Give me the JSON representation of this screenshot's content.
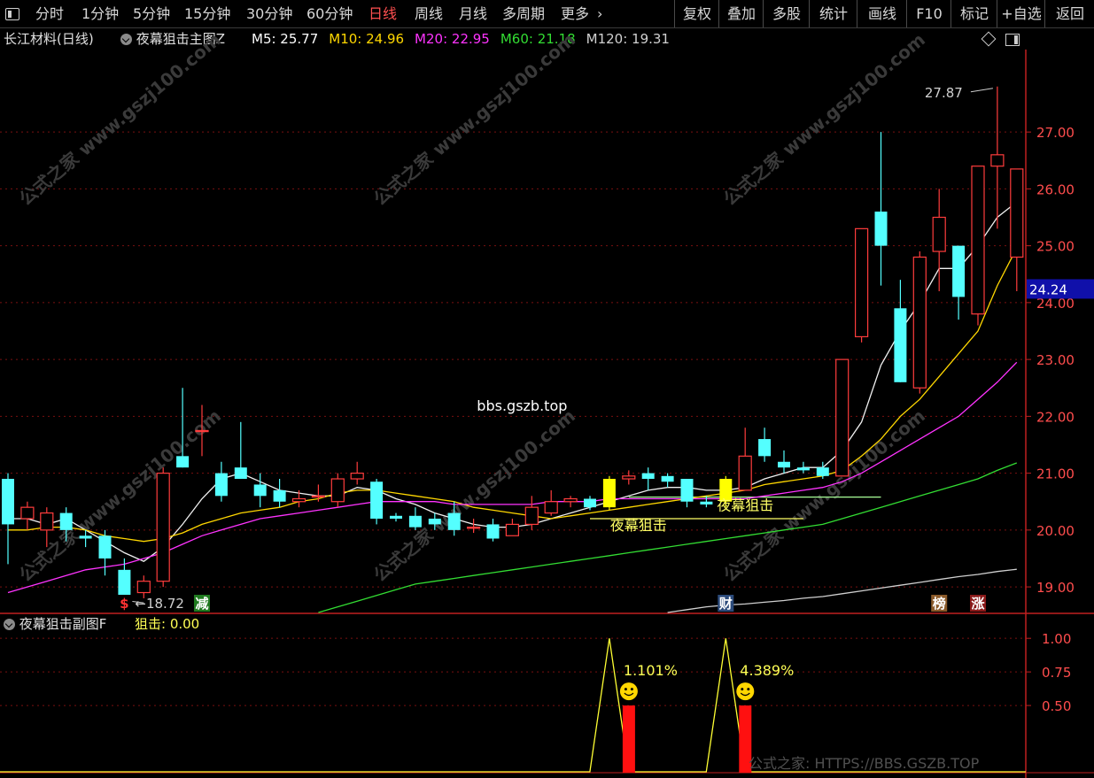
{
  "toolbar": {
    "periods": [
      "分时",
      "1分钟",
      "5分钟",
      "15分钟",
      "30分钟",
      "60分钟",
      "日线",
      "周线",
      "月线",
      "多周期",
      "更多"
    ],
    "more_icon": "chevron-right-icon",
    "right_buttons": [
      "复权",
      "叠加",
      "多股",
      "统计",
      "画线",
      "F10",
      "标记",
      "+自选",
      "返回"
    ]
  },
  "header": {
    "stock": "长江材料(日线)",
    "indicator": "夜幕狙击主图Z",
    "ma": [
      {
        "label": "M5: 25.77",
        "color": "#ffffff"
      },
      {
        "label": "M10: 24.96",
        "color": "#ffd700"
      },
      {
        "label": "M20: 22.95",
        "color": "#ff33ff"
      },
      {
        "label": "M60: 21.18",
        "color": "#33dd33"
      },
      {
        "label": "M120: 19.31",
        "color": "#d0d0d0"
      }
    ]
  },
  "chart_data": {
    "type": "candlestick",
    "ylim": [
      18.55,
      28.45
    ],
    "y_ticks": [
      "19.00",
      "20.00",
      "21.00",
      "22.00",
      "23.00",
      "24.00",
      "25.00",
      "26.00",
      "27.00"
    ],
    "current_price": "24.24",
    "high_label": "27.87",
    "low_label": "18.72",
    "candles": [
      [
        20.9,
        20.1,
        21.0,
        19.4
      ],
      [
        20.2,
        20.4,
        20.5,
        20.0
      ],
      [
        20.0,
        20.3,
        20.4,
        19.7
      ],
      [
        20.3,
        20.0,
        20.4,
        19.8
      ],
      [
        19.9,
        19.85,
        20.0,
        19.7
      ],
      [
        19.9,
        19.5,
        20.0,
        19.2
      ],
      [
        19.3,
        18.8,
        19.5,
        18.7
      ],
      [
        18.9,
        19.1,
        19.2,
        18.8
      ],
      [
        19.1,
        21.0,
        21.1,
        19.0
      ],
      [
        21.3,
        21.1,
        22.5,
        21.1
      ],
      [
        21.75,
        21.75,
        22.2,
        21.3
      ],
      [
        21.0,
        20.6,
        21.2,
        20.5
      ],
      [
        21.1,
        20.9,
        21.9,
        20.9
      ],
      [
        20.8,
        20.6,
        21.0,
        20.4
      ],
      [
        20.7,
        20.5,
        20.9,
        20.4
      ],
      [
        20.5,
        20.55,
        20.7,
        20.4
      ],
      [
        20.6,
        20.6,
        20.8,
        20.5
      ],
      [
        20.5,
        20.9,
        21.0,
        20.4
      ],
      [
        20.9,
        21.0,
        21.2,
        20.8
      ],
      [
        20.85,
        20.2,
        20.9,
        20.1
      ],
      [
        20.25,
        20.2,
        20.3,
        20.15
      ],
      [
        20.25,
        20.05,
        20.4,
        20.0
      ],
      [
        20.2,
        20.1,
        20.3,
        20.0
      ],
      [
        20.3,
        20.0,
        20.5,
        19.9
      ],
      [
        20.05,
        20.05,
        20.2,
        19.95
      ],
      [
        20.1,
        19.85,
        20.2,
        19.8
      ],
      [
        19.9,
        20.1,
        20.2,
        19.9
      ],
      [
        20.1,
        20.4,
        20.6,
        20.0
      ],
      [
        20.3,
        20.5,
        20.7,
        20.25
      ],
      [
        20.5,
        20.55,
        20.6,
        20.4
      ],
      [
        20.55,
        20.4,
        20.6,
        20.35
      ],
      [
        20.4,
        20.9,
        20.95,
        20.35
      ],
      [
        20.9,
        20.95,
        21.05,
        20.8
      ],
      [
        21.0,
        20.9,
        21.1,
        20.7
      ],
      [
        20.95,
        20.85,
        21.0,
        20.75
      ],
      [
        20.9,
        20.5,
        20.9,
        20.4
      ],
      [
        20.5,
        20.45,
        20.6,
        20.4
      ],
      [
        20.5,
        20.9,
        20.95,
        20.4
      ],
      [
        20.7,
        21.3,
        21.8,
        20.7
      ],
      [
        21.6,
        21.3,
        21.8,
        21.2
      ],
      [
        21.2,
        21.1,
        21.4,
        21.0
      ],
      [
        21.1,
        21.05,
        21.2,
        21.0
      ],
      [
        21.1,
        20.95,
        21.2,
        20.9
      ],
      [
        20.95,
        23.0,
        23.0,
        20.95
      ],
      [
        23.4,
        25.3,
        25.3,
        23.3
      ],
      [
        25.6,
        25.0,
        27.0,
        24.3
      ],
      [
        23.9,
        22.6,
        24.4,
        22.6
      ],
      [
        22.5,
        24.8,
        24.9,
        22.4
      ],
      [
        24.9,
        25.5,
        26.0,
        24.2
      ],
      [
        25.0,
        24.1,
        25.0,
        23.7
      ],
      [
        23.8,
        26.4,
        26.4,
        23.6
      ],
      [
        26.4,
        26.6,
        27.8,
        25.3
      ],
      [
        24.8,
        26.35,
        26.35,
        24.2
      ]
    ],
    "up_color": "#ff3c3c",
    "down_color": "#54ffff",
    "ma_series": [
      {
        "name": "M5",
        "color": "#f0f0f0",
        "values": [
          20.2,
          20.2,
          20.1,
          20.2,
          20.0,
          19.8,
          19.6,
          19.45,
          19.7,
          20.1,
          20.55,
          20.9,
          21.0,
          20.85,
          20.7,
          20.65,
          20.6,
          20.6,
          20.75,
          20.7,
          20.55,
          20.45,
          20.3,
          20.2,
          20.1,
          20.05,
          20.05,
          20.1,
          20.2,
          20.3,
          20.4,
          20.5,
          20.6,
          20.7,
          20.75,
          20.75,
          20.7,
          20.7,
          20.75,
          20.9,
          21.0,
          21.1,
          21.1,
          21.4,
          21.9,
          22.9,
          23.5,
          24.0,
          24.6,
          24.6,
          25.0,
          25.5,
          25.77
        ]
      },
      {
        "name": "M10",
        "color": "#ffd700",
        "values": [
          20.0,
          20.0,
          20.05,
          20.05,
          20.0,
          19.9,
          19.85,
          19.8,
          19.85,
          19.95,
          20.1,
          20.2,
          20.3,
          20.35,
          20.4,
          20.5,
          20.55,
          20.65,
          20.7,
          20.7,
          20.65,
          20.6,
          20.55,
          20.5,
          20.4,
          20.35,
          20.3,
          20.25,
          20.2,
          20.25,
          20.3,
          20.35,
          20.4,
          20.45,
          20.5,
          20.55,
          20.6,
          20.65,
          20.7,
          20.8,
          20.85,
          20.9,
          20.95,
          21.05,
          21.3,
          21.6,
          22.0,
          22.3,
          22.7,
          23.1,
          23.5,
          24.3,
          24.96
        ]
      },
      {
        "name": "M20",
        "color": "#ff33ff",
        "values": [
          18.9,
          19.0,
          19.1,
          19.2,
          19.3,
          19.35,
          19.4,
          19.5,
          19.6,
          19.75,
          19.9,
          20.0,
          20.1,
          20.2,
          20.25,
          20.3,
          20.35,
          20.4,
          20.45,
          20.5,
          20.5,
          20.5,
          20.5,
          20.45,
          20.45,
          20.45,
          20.45,
          20.45,
          20.5,
          20.5,
          20.5,
          20.55,
          20.55,
          20.55,
          20.55,
          20.55,
          20.55,
          20.55,
          20.55,
          20.6,
          20.65,
          20.7,
          20.75,
          20.85,
          21.0,
          21.2,
          21.4,
          21.6,
          21.8,
          22.0,
          22.3,
          22.6,
          22.95
        ]
      },
      {
        "name": "M60",
        "color": "#33dd33",
        "values": [
          null,
          null,
          null,
          null,
          null,
          null,
          null,
          null,
          null,
          null,
          null,
          null,
          null,
          null,
          null,
          null,
          18.55,
          18.65,
          18.75,
          18.85,
          18.95,
          19.05,
          19.1,
          19.15,
          19.2,
          19.25,
          19.3,
          19.35,
          19.4,
          19.45,
          19.5,
          19.55,
          19.6,
          19.65,
          19.7,
          19.75,
          19.8,
          19.85,
          19.9,
          19.95,
          20.0,
          20.05,
          20.1,
          20.2,
          20.3,
          20.4,
          20.5,
          20.6,
          20.7,
          20.8,
          20.9,
          21.05,
          21.18
        ]
      },
      {
        "name": "M120",
        "color": "#cfcfcf",
        "values": [
          null,
          null,
          null,
          null,
          null,
          null,
          null,
          null,
          null,
          null,
          null,
          null,
          null,
          null,
          null,
          null,
          null,
          null,
          null,
          null,
          null,
          null,
          null,
          null,
          null,
          null,
          null,
          null,
          null,
          null,
          null,
          null,
          null,
          null,
          18.55,
          18.6,
          18.65,
          18.68,
          18.7,
          18.73,
          18.76,
          18.8,
          18.83,
          18.88,
          18.93,
          18.98,
          19.03,
          19.08,
          19.13,
          19.18,
          19.22,
          19.27,
          19.31
        ]
      }
    ],
    "horizontal_lines": [
      {
        "y": 20.2,
        "x0": 30,
        "x1": 41,
        "color": "#ffff66"
      },
      {
        "y": 20.58,
        "x0": 32,
        "x1": 45,
        "color": "#aaff99"
      }
    ],
    "annotations": [
      {
        "text": "夜幕狙击",
        "x": 32.5,
        "y": 20.0,
        "color": "#ffff66"
      },
      {
        "text": "夜幕狙击",
        "x": 38.0,
        "y": 20.35,
        "color": "#ffff66"
      },
      {
        "text": "bbs.gszb.top",
        "x": 26.5,
        "y": 22.1,
        "color": "#ffffff"
      }
    ],
    "markers": [
      {
        "text": "$",
        "index": 6,
        "color": "#ff3333",
        "bg": "#000000"
      },
      {
        "text": "减",
        "index": 10,
        "color": "#ffffff",
        "bg": "#1f7a1f"
      },
      {
        "text": "财",
        "index": 37,
        "color": "#ffffff",
        "bg": "#2b4a7a"
      },
      {
        "text": "榜",
        "index": 48,
        "color": "#ffffff",
        "bg": "#8a5a2a"
      },
      {
        "text": "涨",
        "index": 50,
        "color": "#ffffff",
        "bg": "#8a1a1a"
      }
    ],
    "highlight_bars": [
      31,
      37
    ],
    "watermark": "公式之家 www.gszj100.com"
  },
  "subchart": {
    "title": "夜幕狙击副图F",
    "value_label": "狙击: 0.00",
    "ylim": [
      0,
      1.1
    ],
    "y_ticks": [
      "0.50",
      "0.75",
      "1.00"
    ],
    "signals": [
      {
        "index": 31,
        "value": 1.0,
        "bar": 0.5,
        "pct": "1.101%"
      },
      {
        "index": 37,
        "value": 1.0,
        "bar": 0.5,
        "pct": "4.389%"
      }
    ],
    "footer": "公式之家: HTTPS://BBS.GSZB.TOP"
  }
}
